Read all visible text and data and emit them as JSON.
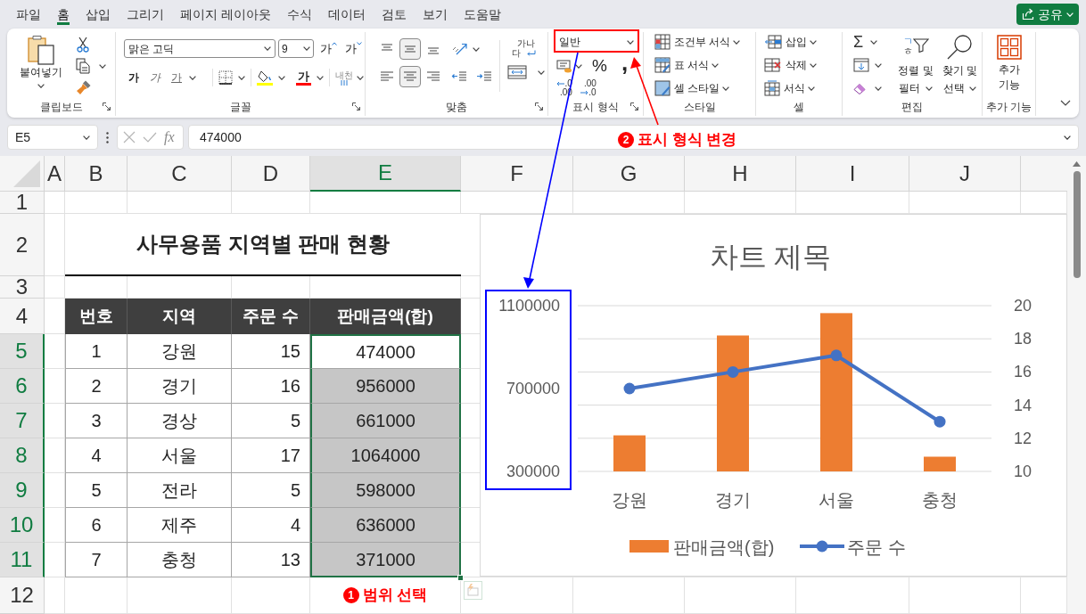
{
  "menu_tabs": [
    {
      "label": "파일",
      "selected": false
    },
    {
      "label": "홈",
      "selected": true
    },
    {
      "label": "삽입",
      "selected": false
    },
    {
      "label": "그리기",
      "selected": false
    },
    {
      "label": "페이지 레이아웃",
      "selected": false
    },
    {
      "label": "수식",
      "selected": false
    },
    {
      "label": "데이터",
      "selected": false
    },
    {
      "label": "검토",
      "selected": false
    },
    {
      "label": "보기",
      "selected": false
    },
    {
      "label": "도움말",
      "selected": false
    }
  ],
  "share_button": {
    "label": "공유"
  },
  "ribbon": {
    "groups": [
      {
        "kind": "clipboard",
        "label": "클립보드",
        "dialog_launcher": true,
        "paste_label": "붙여넣기"
      },
      {
        "kind": "font",
        "label": "글꼴",
        "dialog_launcher": true,
        "font_name": "맑은 고딕",
        "font_size": "9",
        "grow_label": "가",
        "shrink_label": "가",
        "style_buttons": [
          {
            "kind": "bold",
            "label": "가"
          },
          {
            "kind": "italic",
            "label": "가"
          },
          {
            "kind": "underline",
            "label": "가"
          }
        ],
        "font_color_label": "가",
        "phonetic_label": "내천"
      },
      {
        "kind": "alignment",
        "label": "맞춤",
        "dialog_launcher": true,
        "vertical": [
          {
            "kind": "top",
            "selected": false
          },
          {
            "kind": "middle",
            "selected": true
          },
          {
            "kind": "bottom",
            "selected": false
          }
        ],
        "horizontal": [
          {
            "kind": "left",
            "selected": false
          },
          {
            "kind": "center",
            "selected": true
          },
          {
            "kind": "right",
            "selected": false
          }
        ],
        "wrap_text_lines": [
          "가나",
          "다"
        ]
      },
      {
        "kind": "number",
        "label": "표시 형식",
        "dialog_launcher": true,
        "format": "일반",
        "percent": "%",
        "comma": ",",
        "decimal_buttons": [
          {
            "kind": "increase",
            "lines": [
              ".0",
              ".00"
            ]
          },
          {
            "kind": "decrease",
            "lines": [
              ".00",
              ".0"
            ]
          }
        ]
      },
      {
        "kind": "styles",
        "label": "스타일",
        "buttons": [
          {
            "kind": "conditional",
            "label": "조건부 서식"
          },
          {
            "kind": "table",
            "label": "표 서식"
          },
          {
            "kind": "cell",
            "label": "셀 스타일"
          }
        ]
      },
      {
        "kind": "cells",
        "label": "셀",
        "buttons": [
          {
            "kind": "insert",
            "label": "삽입"
          },
          {
            "kind": "delete",
            "label": "삭제"
          },
          {
            "kind": "format",
            "label": "서식"
          }
        ]
      },
      {
        "kind": "editing",
        "label": "편집",
        "sum": "Σ",
        "sort_button": {
          "letters": [
            "ㄱ",
            "ㅎ"
          ],
          "lines": [
            "정렬 및",
            "필터"
          ]
        },
        "find_button": {
          "lines": [
            "찾기 및",
            "선택"
          ]
        }
      },
      {
        "kind": "addins",
        "label": "추가 기능",
        "button_lines": [
          "추가",
          "기능"
        ]
      }
    ]
  },
  "formula_bar": {
    "name_box": "E5",
    "fx": "fx",
    "value": "474000"
  },
  "annotations": [
    {
      "step": "2",
      "label": "표시 형식 변경"
    },
    {
      "step": "1",
      "label": "범위 선택"
    }
  ],
  "sheet": {
    "columns": [
      {
        "label": "A",
        "selected": false
      },
      {
        "label": "B",
        "selected": false
      },
      {
        "label": "C",
        "selected": false
      },
      {
        "label": "D",
        "selected": false
      },
      {
        "label": "E",
        "selected": true
      },
      {
        "label": "F",
        "selected": false
      },
      {
        "label": "G",
        "selected": false
      },
      {
        "label": "H",
        "selected": false
      },
      {
        "label": "I",
        "selected": false
      },
      {
        "label": "J",
        "selected": false
      }
    ],
    "rows": [
      {
        "label": "1",
        "selected": false
      },
      {
        "label": "2",
        "selected": false
      },
      {
        "label": "3",
        "selected": false
      },
      {
        "label": "4",
        "selected": false
      },
      {
        "label": "5",
        "selected": true
      },
      {
        "label": "6",
        "selected": true
      },
      {
        "label": "7",
        "selected": true
      },
      {
        "label": "8",
        "selected": true
      },
      {
        "label": "9",
        "selected": true
      },
      {
        "label": "10",
        "selected": true
      },
      {
        "label": "11",
        "selected": true
      },
      {
        "label": "12",
        "selected": false
      }
    ],
    "title": "사무용품 지역별 판매 현황",
    "table": {
      "columns": [
        "번호",
        "지역",
        "주문 수",
        "판매금액(합)"
      ],
      "rows": [
        {
          "no": "1",
          "region": "강원",
          "orders": "15",
          "amount": "474000",
          "amount_selected": true,
          "amount_active": true
        },
        {
          "no": "2",
          "region": "경기",
          "orders": "16",
          "amount": "956000",
          "amount_selected": true,
          "amount_active": false
        },
        {
          "no": "3",
          "region": "경상",
          "orders": "5",
          "amount": "661000",
          "amount_selected": true,
          "amount_active": false
        },
        {
          "no": "4",
          "region": "서울",
          "orders": "17",
          "amount": "1064000",
          "amount_selected": true,
          "amount_active": false
        },
        {
          "no": "5",
          "region": "전라",
          "orders": "5",
          "amount": "598000",
          "amount_selected": true,
          "amount_active": false
        },
        {
          "no": "6",
          "region": "제주",
          "orders": "4",
          "amount": "636000",
          "amount_selected": true,
          "amount_active": false
        },
        {
          "no": "7",
          "region": "충청",
          "orders": "13",
          "amount": "371000",
          "amount_selected": true,
          "amount_active": false
        }
      ]
    }
  },
  "chart": {
    "bar_chart": {
      "chart_data": {
        "type": "bar",
        "title": "차트 제목",
        "categories": [
          "강원",
          "경기",
          "서울",
          "충청"
        ],
        "series": [
          {
            "name": "판매금액(합)",
            "color": "#ed7d31",
            "values": [
              474000,
              956000,
              1064000,
              371000
            ]
          }
        ],
        "ylim": [
          300000,
          1100000
        ],
        "yticks": [
          300000,
          700000,
          1100000
        ]
      }
    },
    "line_chart": {
      "chart_data": {
        "type": "line",
        "series": [
          {
            "name": "주문 수",
            "color": "#4472c4",
            "marker": "circle",
            "values": [
              15,
              16,
              17,
              13
            ]
          }
        ],
        "ylim": [
          10,
          20
        ],
        "yticks": [
          10,
          12,
          14,
          16,
          18,
          20
        ]
      }
    }
  }
}
